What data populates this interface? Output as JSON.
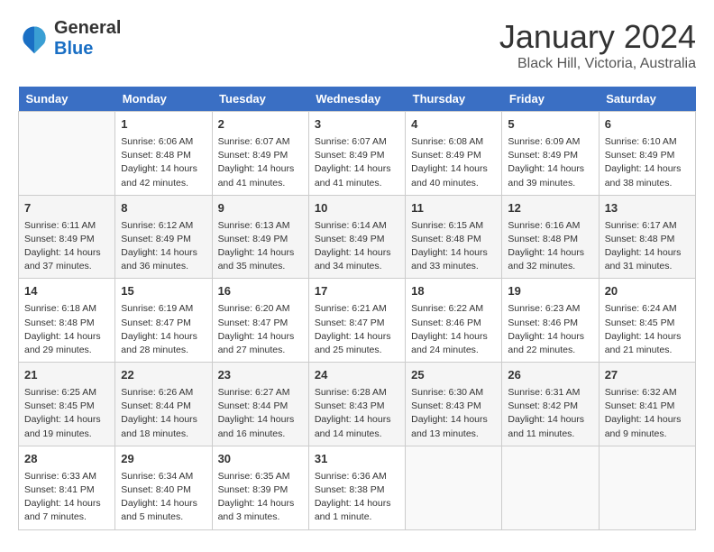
{
  "header": {
    "logo_line1": "General",
    "logo_line2": "Blue",
    "month_title": "January 2024",
    "location": "Black Hill, Victoria, Australia"
  },
  "calendar": {
    "days_of_week": [
      "Sunday",
      "Monday",
      "Tuesday",
      "Wednesday",
      "Thursday",
      "Friday",
      "Saturday"
    ],
    "weeks": [
      [
        {
          "day": "",
          "info": ""
        },
        {
          "day": "1",
          "info": "Sunrise: 6:06 AM\nSunset: 8:48 PM\nDaylight: 14 hours\nand 42 minutes."
        },
        {
          "day": "2",
          "info": "Sunrise: 6:07 AM\nSunset: 8:49 PM\nDaylight: 14 hours\nand 41 minutes."
        },
        {
          "day": "3",
          "info": "Sunrise: 6:07 AM\nSunset: 8:49 PM\nDaylight: 14 hours\nand 41 minutes."
        },
        {
          "day": "4",
          "info": "Sunrise: 6:08 AM\nSunset: 8:49 PM\nDaylight: 14 hours\nand 40 minutes."
        },
        {
          "day": "5",
          "info": "Sunrise: 6:09 AM\nSunset: 8:49 PM\nDaylight: 14 hours\nand 39 minutes."
        },
        {
          "day": "6",
          "info": "Sunrise: 6:10 AM\nSunset: 8:49 PM\nDaylight: 14 hours\nand 38 minutes."
        }
      ],
      [
        {
          "day": "7",
          "info": "Sunrise: 6:11 AM\nSunset: 8:49 PM\nDaylight: 14 hours\nand 37 minutes."
        },
        {
          "day": "8",
          "info": "Sunrise: 6:12 AM\nSunset: 8:49 PM\nDaylight: 14 hours\nand 36 minutes."
        },
        {
          "day": "9",
          "info": "Sunrise: 6:13 AM\nSunset: 8:49 PM\nDaylight: 14 hours\nand 35 minutes."
        },
        {
          "day": "10",
          "info": "Sunrise: 6:14 AM\nSunset: 8:49 PM\nDaylight: 14 hours\nand 34 minutes."
        },
        {
          "day": "11",
          "info": "Sunrise: 6:15 AM\nSunset: 8:48 PM\nDaylight: 14 hours\nand 33 minutes."
        },
        {
          "day": "12",
          "info": "Sunrise: 6:16 AM\nSunset: 8:48 PM\nDaylight: 14 hours\nand 32 minutes."
        },
        {
          "day": "13",
          "info": "Sunrise: 6:17 AM\nSunset: 8:48 PM\nDaylight: 14 hours\nand 31 minutes."
        }
      ],
      [
        {
          "day": "14",
          "info": "Sunrise: 6:18 AM\nSunset: 8:48 PM\nDaylight: 14 hours\nand 29 minutes."
        },
        {
          "day": "15",
          "info": "Sunrise: 6:19 AM\nSunset: 8:47 PM\nDaylight: 14 hours\nand 28 minutes."
        },
        {
          "day": "16",
          "info": "Sunrise: 6:20 AM\nSunset: 8:47 PM\nDaylight: 14 hours\nand 27 minutes."
        },
        {
          "day": "17",
          "info": "Sunrise: 6:21 AM\nSunset: 8:47 PM\nDaylight: 14 hours\nand 25 minutes."
        },
        {
          "day": "18",
          "info": "Sunrise: 6:22 AM\nSunset: 8:46 PM\nDaylight: 14 hours\nand 24 minutes."
        },
        {
          "day": "19",
          "info": "Sunrise: 6:23 AM\nSunset: 8:46 PM\nDaylight: 14 hours\nand 22 minutes."
        },
        {
          "day": "20",
          "info": "Sunrise: 6:24 AM\nSunset: 8:45 PM\nDaylight: 14 hours\nand 21 minutes."
        }
      ],
      [
        {
          "day": "21",
          "info": "Sunrise: 6:25 AM\nSunset: 8:45 PM\nDaylight: 14 hours\nand 19 minutes."
        },
        {
          "day": "22",
          "info": "Sunrise: 6:26 AM\nSunset: 8:44 PM\nDaylight: 14 hours\nand 18 minutes."
        },
        {
          "day": "23",
          "info": "Sunrise: 6:27 AM\nSunset: 8:44 PM\nDaylight: 14 hours\nand 16 minutes."
        },
        {
          "day": "24",
          "info": "Sunrise: 6:28 AM\nSunset: 8:43 PM\nDaylight: 14 hours\nand 14 minutes."
        },
        {
          "day": "25",
          "info": "Sunrise: 6:30 AM\nSunset: 8:43 PM\nDaylight: 14 hours\nand 13 minutes."
        },
        {
          "day": "26",
          "info": "Sunrise: 6:31 AM\nSunset: 8:42 PM\nDaylight: 14 hours\nand 11 minutes."
        },
        {
          "day": "27",
          "info": "Sunrise: 6:32 AM\nSunset: 8:41 PM\nDaylight: 14 hours\nand 9 minutes."
        }
      ],
      [
        {
          "day": "28",
          "info": "Sunrise: 6:33 AM\nSunset: 8:41 PM\nDaylight: 14 hours\nand 7 minutes."
        },
        {
          "day": "29",
          "info": "Sunrise: 6:34 AM\nSunset: 8:40 PM\nDaylight: 14 hours\nand 5 minutes."
        },
        {
          "day": "30",
          "info": "Sunrise: 6:35 AM\nSunset: 8:39 PM\nDaylight: 14 hours\nand 3 minutes."
        },
        {
          "day": "31",
          "info": "Sunrise: 6:36 AM\nSunset: 8:38 PM\nDaylight: 14 hours\nand 1 minute."
        },
        {
          "day": "",
          "info": ""
        },
        {
          "day": "",
          "info": ""
        },
        {
          "day": "",
          "info": ""
        }
      ]
    ]
  }
}
